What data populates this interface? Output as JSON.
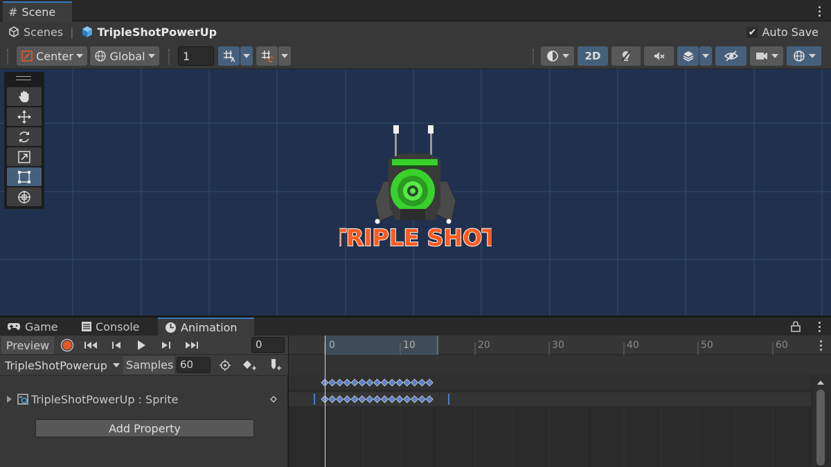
{
  "scene_window": {
    "tab_label": "Scene",
    "breadcrumb": {
      "root": "Scenes",
      "separator": "|",
      "prefab": "TripleShotPowerUp"
    },
    "auto_save": {
      "label": "Auto Save",
      "checked": true,
      "check_glyph": "✔"
    },
    "toolbar": {
      "pivot_mode": "Center",
      "pivot_rotation": "Global",
      "grid_value": "1",
      "mode_2d": "2D"
    }
  },
  "tools": [
    "hand-icon",
    "move-icon",
    "rotate-icon",
    "scale-icon",
    "rect-icon",
    "transform-icon"
  ],
  "active_tool": "rect-icon",
  "sprite": {
    "text": "TRIPLE SHOT",
    "text_color": "#ff5a1f",
    "outline_color": "#ffffff",
    "accent": "#39d12c"
  },
  "bottom_tabs": {
    "game": "Game",
    "console": "Console",
    "animation": "Animation"
  },
  "animation": {
    "preview_label": "Preview",
    "current_frame": "0",
    "clip_name": "TripleShotPowerup",
    "samples_label": "Samples",
    "samples_value": "60",
    "property_label": "TripleShotPowerUp : Sprite",
    "add_property_label": "Add Property",
    "ruler_ticks": [
      "0",
      "10",
      "20",
      "30",
      "40",
      "50",
      "60"
    ],
    "keyframe_count": 15,
    "keyframe_color": "#5b7fc1"
  },
  "colors": {
    "accent_blue": "#3a79bb",
    "record_red": "#e4582a",
    "viewport": "#1f314e"
  }
}
